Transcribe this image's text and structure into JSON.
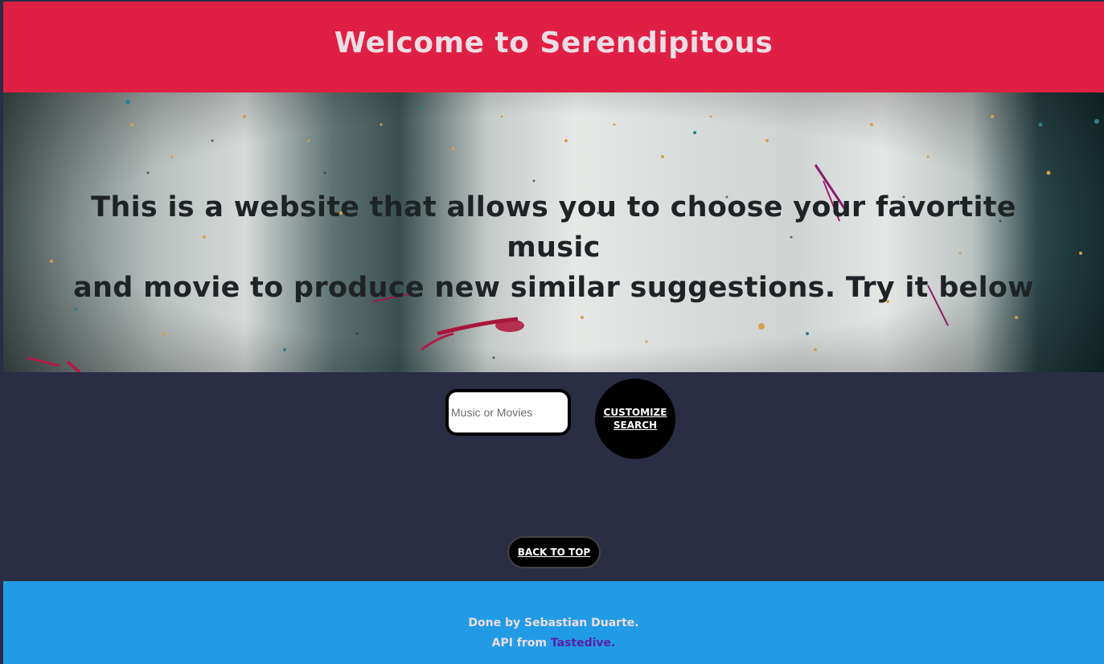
{
  "header": {
    "title": "Welcome to Serendipitous"
  },
  "hero": {
    "line1": "This is a website that allows you to choose your favortite music",
    "line2": "and movie to produce new similar suggestions. Try it below"
  },
  "search": {
    "placeholder": "Music or Movies",
    "value": "",
    "customize_line1": "CUSTOMIZE",
    "customize_line2": "SEARCH"
  },
  "back_to_top": {
    "label": "BACK TO TOP"
  },
  "footer": {
    "credit": "Done by Sebastian Duarte.",
    "api_prefix": "API from ",
    "api_link": "Tastedive."
  },
  "colors": {
    "header_bg": "#e01f44",
    "body_bg": "#2a2d43",
    "footer_bg": "#229be6",
    "link": "#5b1da8"
  }
}
